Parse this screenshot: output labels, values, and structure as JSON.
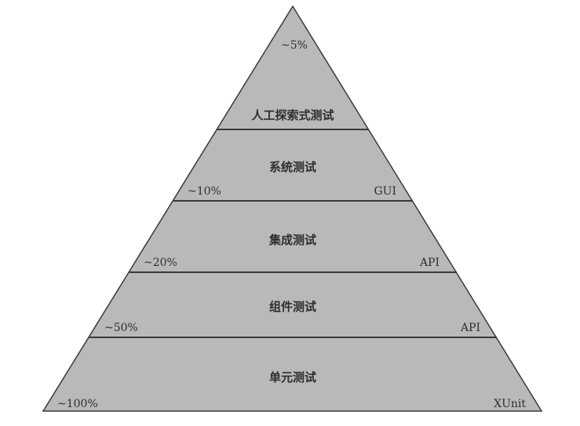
{
  "colors": {
    "fill": "#b9b9b9",
    "line": "#3a3a3a",
    "text": "#2e2e2e"
  },
  "layers": [
    {
      "name": "人工探索式测试",
      "percent": "~5%",
      "tool": ""
    },
    {
      "name": "系统测试",
      "percent": "~10%",
      "tool": "GUI"
    },
    {
      "name": "集成测试",
      "percent": "~20%",
      "tool": "API"
    },
    {
      "name": "组件测试",
      "percent": "~50%",
      "tool": "API"
    },
    {
      "name": "单元测试",
      "percent": "~100%",
      "tool": "XUnit"
    }
  ]
}
